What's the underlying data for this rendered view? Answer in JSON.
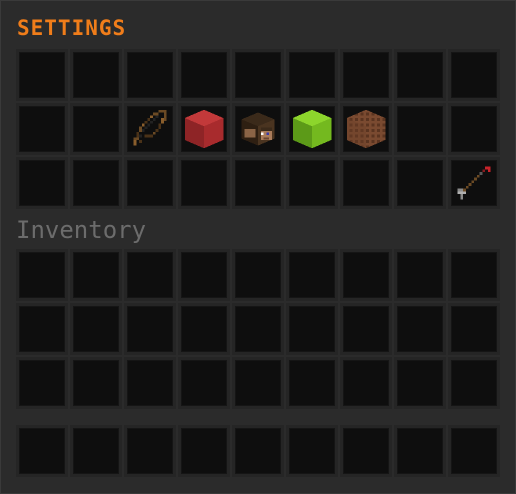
{
  "window": {
    "title": "SETTINGS",
    "inventory_label": "Inventory"
  },
  "colors": {
    "title": "#f07d1a",
    "label": "#6c6c6c",
    "slot_bg": "#0e0e0e",
    "panel_bg": "#2b2b2b"
  },
  "settings_grid": {
    "rows": 3,
    "columns": 9,
    "items": [
      {
        "row": 1,
        "col": 2,
        "icon": "bow-icon"
      },
      {
        "row": 1,
        "col": 3,
        "icon": "red-wool-block-icon"
      },
      {
        "row": 1,
        "col": 4,
        "icon": "player-head-icon"
      },
      {
        "row": 1,
        "col": 5,
        "icon": "lime-wool-block-icon"
      },
      {
        "row": 1,
        "col": 6,
        "icon": "note-block-icon"
      },
      {
        "row": 2,
        "col": 8,
        "icon": "arrow-icon"
      }
    ]
  },
  "inventory_grid": {
    "rows": 3,
    "columns": 9
  },
  "hotbar": {
    "rows": 1,
    "columns": 9
  }
}
